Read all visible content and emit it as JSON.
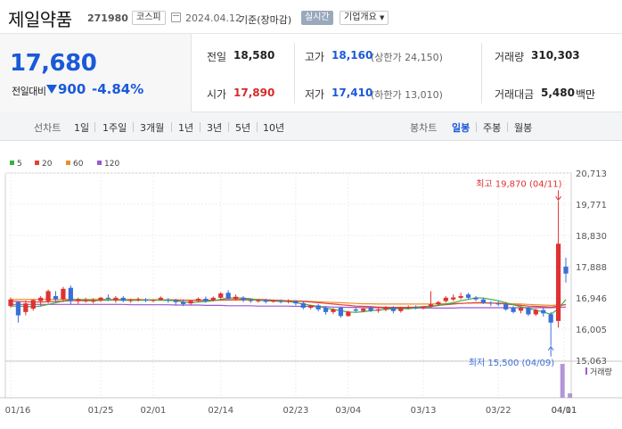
{
  "header": {
    "name": "제일약품",
    "code": "271980",
    "market": "코스피",
    "date": "2024.04.12",
    "basis": "기준(장마감)",
    "realtime_label": "실시간",
    "company_info_label": "기업개요"
  },
  "quote": {
    "price": "17,680",
    "change_label": "전일대비",
    "change": "900",
    "change_pct": "-4.84%",
    "prev_close_label": "전일",
    "prev_close": "18,580",
    "open_label": "시가",
    "open": "17,890",
    "high_label": "고가",
    "high": "18,160",
    "upper_limit": "(상한가 24,150)",
    "low_label": "저가",
    "low": "17,410",
    "lower_limit": "(하한가 13,010)",
    "volume_label": "거래량",
    "volume": "310,303",
    "trade_value_label": "거래대금",
    "trade_value": "5,480",
    "trade_value_unit": "백만"
  },
  "toolbar": {
    "line_chart_label": "선차트",
    "periods": [
      "1일",
      "1주일",
      "3개월",
      "1년",
      "3년",
      "5년",
      "10년"
    ],
    "candle_chart_label": "봉차트",
    "candle_periods": [
      "일봉",
      "주봉",
      "월봉"
    ],
    "selected_candle": "일봉"
  },
  "colors": {
    "up": "#e03131",
    "down": "#3b6fd8",
    "ma5": "#3cb043",
    "ma20": "#e0413a",
    "ma60": "#f08c28",
    "ma120": "#9b59d0"
  },
  "chart_data": {
    "type": "candlestick",
    "legend": [
      "5",
      "20",
      "60",
      "120"
    ],
    "y_ticks": [
      20713,
      19771,
      18830,
      17888,
      16946,
      16005,
      15063
    ],
    "y_tick_labels": [
      "20,713",
      "19,771",
      "18,830",
      "17,888",
      "16,946",
      "16,005",
      "15,063"
    ],
    "ylim": [
      15063,
      20713
    ],
    "x_ticks": [
      "01/16",
      "01/25",
      "02/01",
      "02/14",
      "02/23",
      "03/04",
      "03/13",
      "03/22",
      "04/01",
      "04/11"
    ],
    "high_annotation": "최고 19,870 (04/11)",
    "low_annotation": "최저 15,500 (04/09)",
    "volume_label": "거래량",
    "candles": [
      {
        "o": 16700,
        "h": 16960,
        "c": 16900,
        "l": 16650
      },
      {
        "o": 16820,
        "h": 16850,
        "c": 16420,
        "l": 16200
      },
      {
        "o": 16520,
        "h": 16870,
        "c": 16780,
        "l": 16420
      },
      {
        "o": 16620,
        "h": 16900,
        "c": 16880,
        "l": 16560
      },
      {
        "o": 16850,
        "h": 17000,
        "c": 16950,
        "l": 16700
      },
      {
        "o": 16850,
        "h": 17200,
        "c": 17150,
        "l": 16780
      },
      {
        "o": 17000,
        "h": 17150,
        "c": 16900,
        "l": 16820
      },
      {
        "o": 16900,
        "h": 17280,
        "c": 17220,
        "l": 16820
      },
      {
        "o": 17250,
        "h": 17320,
        "c": 16850,
        "l": 16750
      },
      {
        "o": 16850,
        "h": 16950,
        "c": 16900,
        "l": 16760
      },
      {
        "o": 16850,
        "h": 16950,
        "c": 16870,
        "l": 16800
      },
      {
        "o": 16850,
        "h": 16940,
        "c": 16860,
        "l": 16780
      },
      {
        "o": 16880,
        "h": 16980,
        "c": 16950,
        "l": 16830
      },
      {
        "o": 16950,
        "h": 17050,
        "c": 16920,
        "l": 16850
      },
      {
        "o": 16880,
        "h": 17000,
        "c": 16950,
        "l": 16800
      },
      {
        "o": 16950,
        "h": 17000,
        "c": 16860,
        "l": 16820
      },
      {
        "o": 16860,
        "h": 16920,
        "c": 16880,
        "l": 16800
      },
      {
        "o": 16900,
        "h": 16960,
        "c": 16910,
        "l": 16840
      },
      {
        "o": 16900,
        "h": 16940,
        "c": 16870,
        "l": 16820
      },
      {
        "o": 16870,
        "h": 16900,
        "c": 16880,
        "l": 16820
      },
      {
        "o": 16900,
        "h": 16990,
        "c": 16950,
        "l": 16860
      },
      {
        "o": 16900,
        "h": 16940,
        "c": 16880,
        "l": 16800
      },
      {
        "o": 16870,
        "h": 16920,
        "c": 16820,
        "l": 16740
      },
      {
        "o": 16820,
        "h": 16900,
        "c": 16760,
        "l": 16700
      },
      {
        "o": 16780,
        "h": 16880,
        "c": 16850,
        "l": 16740
      },
      {
        "o": 16850,
        "h": 16960,
        "c": 16920,
        "l": 16820
      },
      {
        "o": 16920,
        "h": 16990,
        "c": 16850,
        "l": 16800
      },
      {
        "o": 16880,
        "h": 16990,
        "c": 16950,
        "l": 16840
      },
      {
        "o": 16950,
        "h": 17120,
        "c": 17080,
        "l": 16900
      },
      {
        "o": 17100,
        "h": 17180,
        "c": 16920,
        "l": 16880
      },
      {
        "o": 16920,
        "h": 17050,
        "c": 16980,
        "l": 16860
      },
      {
        "o": 16950,
        "h": 17000,
        "c": 16880,
        "l": 16820
      },
      {
        "o": 16880,
        "h": 16930,
        "c": 16850,
        "l": 16800
      },
      {
        "o": 16850,
        "h": 16900,
        "c": 16870,
        "l": 16800
      },
      {
        "o": 16880,
        "h": 16920,
        "c": 16830,
        "l": 16780
      },
      {
        "o": 16840,
        "h": 16880,
        "c": 16860,
        "l": 16800
      },
      {
        "o": 16850,
        "h": 16900,
        "c": 16830,
        "l": 16780
      },
      {
        "o": 16840,
        "h": 16900,
        "c": 16860,
        "l": 16780
      },
      {
        "o": 16850,
        "h": 16880,
        "c": 16780,
        "l": 16720
      },
      {
        "o": 16790,
        "h": 16830,
        "c": 16650,
        "l": 16600
      },
      {
        "o": 16650,
        "h": 16740,
        "c": 16720,
        "l": 16600
      },
      {
        "o": 16720,
        "h": 16760,
        "c": 16600,
        "l": 16540
      },
      {
        "o": 16640,
        "h": 16700,
        "c": 16520,
        "l": 16440
      },
      {
        "o": 16520,
        "h": 16640,
        "c": 16600,
        "l": 16460
      },
      {
        "o": 16650,
        "h": 16680,
        "c": 16400,
        "l": 16350
      },
      {
        "o": 16400,
        "h": 16560,
        "c": 16530,
        "l": 16380
      },
      {
        "o": 16600,
        "h": 16650,
        "c": 16560,
        "l": 16500
      },
      {
        "o": 16550,
        "h": 16640,
        "c": 16620,
        "l": 16520
      },
      {
        "o": 16640,
        "h": 16700,
        "c": 16560,
        "l": 16520
      },
      {
        "o": 16560,
        "h": 16650,
        "c": 16600,
        "l": 16500
      },
      {
        "o": 16600,
        "h": 16700,
        "c": 16650,
        "l": 16540
      },
      {
        "o": 16650,
        "h": 16700,
        "c": 16550,
        "l": 16480
      },
      {
        "o": 16550,
        "h": 16680,
        "c": 16640,
        "l": 16500
      },
      {
        "o": 16650,
        "h": 16720,
        "c": 16660,
        "l": 16600
      },
      {
        "o": 16660,
        "h": 16720,
        "c": 16640,
        "l": 16600
      },
      {
        "o": 16640,
        "h": 16700,
        "c": 16680,
        "l": 16600
      },
      {
        "o": 16690,
        "h": 17150,
        "c": 16750,
        "l": 16650
      },
      {
        "o": 16750,
        "h": 16850,
        "c": 16820,
        "l": 16700
      },
      {
        "o": 16850,
        "h": 17000,
        "c": 16950,
        "l": 16800
      },
      {
        "o": 16900,
        "h": 17050,
        "c": 16960,
        "l": 16850
      },
      {
        "o": 16950,
        "h": 17100,
        "c": 17000,
        "l": 16900
      },
      {
        "o": 17050,
        "h": 17100,
        "c": 16950,
        "l": 16900
      },
      {
        "o": 16950,
        "h": 17000,
        "c": 16900,
        "l": 16850
      },
      {
        "o": 16900,
        "h": 16960,
        "c": 16800,
        "l": 16760
      },
      {
        "o": 16800,
        "h": 16850,
        "c": 16780,
        "l": 16700
      },
      {
        "o": 16780,
        "h": 16850,
        "c": 16750,
        "l": 16700
      },
      {
        "o": 16750,
        "h": 16820,
        "c": 16600,
        "l": 16560
      },
      {
        "o": 16650,
        "h": 16700,
        "c": 16520,
        "l": 16480
      },
      {
        "o": 16560,
        "h": 16680,
        "c": 16640,
        "l": 16480
      },
      {
        "o": 16650,
        "h": 16680,
        "c": 16450,
        "l": 16400
      },
      {
        "o": 16450,
        "h": 16620,
        "c": 16580,
        "l": 16400
      },
      {
        "o": 16580,
        "h": 16650,
        "c": 16480,
        "l": 16380
      },
      {
        "o": 16450,
        "h": 16520,
        "c": 16200,
        "l": 15500
      },
      {
        "o": 16250,
        "h": 19870,
        "c": 18580,
        "l": 16050
      },
      {
        "o": 17890,
        "h": 18160,
        "c": 17680,
        "l": 17410
      }
    ],
    "ma": {
      "5": [
        16700,
        16700,
        16690,
        16680,
        16700,
        16750,
        16800,
        16850,
        16900,
        16900,
        16880,
        16880,
        16880,
        16890,
        16880,
        16880,
        16870,
        16880,
        16880,
        16880,
        16880,
        16870,
        16860,
        16820,
        16800,
        16820,
        16840,
        16860,
        16900,
        16940,
        16950,
        16940,
        16920,
        16880,
        16860,
        16850,
        16840,
        16840,
        16800,
        16760,
        16720,
        16690,
        16640,
        16600,
        16560,
        16520,
        16510,
        16530,
        16560,
        16580,
        16600,
        16620,
        16620,
        16620,
        16640,
        16660,
        16680,
        16720,
        16760,
        16800,
        16860,
        16900,
        16950,
        16940,
        16900,
        16860,
        16800,
        16740,
        16680,
        16620,
        16580,
        16520,
        16450,
        16620,
        16900
      ],
      "20": [
        16850,
        16840,
        16830,
        16820,
        16820,
        16830,
        16840,
        16850,
        16860,
        16860,
        16860,
        16860,
        16870,
        16880,
        16880,
        16880,
        16880,
        16880,
        16880,
        16880,
        16880,
        16880,
        16880,
        16870,
        16870,
        16870,
        16870,
        16870,
        16880,
        16890,
        16900,
        16900,
        16900,
        16900,
        16890,
        16880,
        16870,
        16860,
        16850,
        16840,
        16820,
        16800,
        16780,
        16760,
        16740,
        16720,
        16700,
        16690,
        16680,
        16670,
        16660,
        16660,
        16660,
        16660,
        16670,
        16680,
        16700,
        16720,
        16740,
        16760,
        16780,
        16790,
        16800,
        16800,
        16790,
        16780,
        16760,
        16740,
        16720,
        16700,
        16690,
        16680,
        16670,
        16700,
        16750
      ],
      "60": [
        16900,
        16900,
        16900,
        16900,
        16900,
        16900,
        16900,
        16900,
        16900,
        16900,
        16900,
        16900,
        16900,
        16900,
        16900,
        16900,
        16900,
        16900,
        16890,
        16890,
        16890,
        16890,
        16890,
        16880,
        16880,
        16880,
        16880,
        16880,
        16880,
        16880,
        16880,
        16880,
        16880,
        16880,
        16880,
        16870,
        16870,
        16860,
        16860,
        16850,
        16840,
        16830,
        16820,
        16810,
        16800,
        16790,
        16780,
        16770,
        16770,
        16760,
        16760,
        16760,
        16760,
        16760,
        16760,
        16760,
        16760,
        16770,
        16770,
        16780,
        16780,
        16790,
        16790,
        16790,
        16790,
        16790,
        16780,
        16770,
        16760,
        16750,
        16740,
        16730,
        16720,
        16730,
        16740
      ],
      "120": [
        16750,
        16750,
        16750,
        16750,
        16750,
        16750,
        16750,
        16750,
        16750,
        16750,
        16750,
        16750,
        16750,
        16750,
        16750,
        16750,
        16740,
        16740,
        16740,
        16740,
        16740,
        16740,
        16730,
        16730,
        16730,
        16730,
        16720,
        16720,
        16720,
        16710,
        16710,
        16710,
        16710,
        16700,
        16700,
        16700,
        16700,
        16700,
        16690,
        16690,
        16690,
        16680,
        16680,
        16670,
        16670,
        16660,
        16660,
        16650,
        16650,
        16650,
        16640,
        16640,
        16640,
        16640,
        16640,
        16640,
        16640,
        16640,
        16640,
        16640,
        16650,
        16650,
        16650,
        16650,
        16650,
        16650,
        16650,
        16650,
        16650,
        16650,
        16650,
        16650,
        16650,
        16660,
        16670
      ]
    },
    "volumes": [
      {
        "index": 73,
        "value": 1.0,
        "up": false
      },
      {
        "index": 74,
        "value": 0.13,
        "up": false
      }
    ]
  }
}
